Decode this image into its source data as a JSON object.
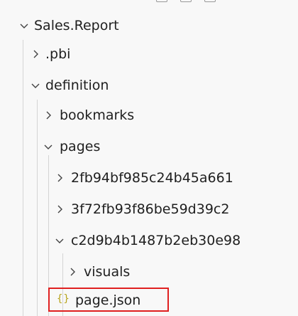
{
  "tree": {
    "root": {
      "label": "Sales.Report",
      "expanded": true
    },
    "items": [
      {
        "key": "pbi",
        "label": ".pbi",
        "expanded": false
      },
      {
        "key": "definition",
        "label": "definition",
        "expanded": true
      },
      {
        "key": "bookmarks",
        "label": "bookmarks",
        "expanded": false
      },
      {
        "key": "pages",
        "label": "pages",
        "expanded": true
      },
      {
        "key": "page1",
        "label": "2fb94bf985c24b45a661",
        "expanded": false
      },
      {
        "key": "page2",
        "label": "3f72fb93f86be59d39c2",
        "expanded": false
      },
      {
        "key": "page3",
        "label": "c2d9b4b1487b2eb30e98",
        "expanded": true
      },
      {
        "key": "visuals",
        "label": "visuals",
        "expanded": false
      }
    ],
    "file": {
      "label": "page.json",
      "icon": "json-braces-icon",
      "icon_glyph": "{}"
    }
  },
  "colors": {
    "highlight_border": "#e02020",
    "json_icon": "#b7a41c"
  }
}
